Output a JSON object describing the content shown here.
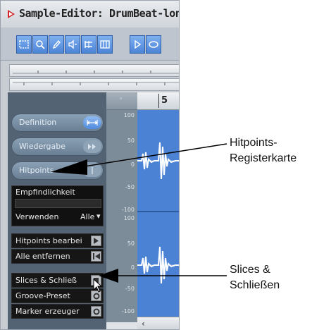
{
  "window": {
    "title": "Sample-Editor: DrumBeat-long"
  },
  "timeline": {
    "bar_label": "5"
  },
  "panel": {
    "tabs": [
      {
        "label": "Definition"
      },
      {
        "label": "Wiedergabe"
      },
      {
        "label": "Hitpoints"
      }
    ],
    "sensitivity_label": "Empfindlichkeit",
    "use_label": "Verwenden",
    "use_value": "Alle",
    "actions": [
      {
        "label": "Hitpoints bearbei"
      },
      {
        "label": "Alle entfernen"
      },
      {
        "label": "Slices & Schließ"
      },
      {
        "label": "Groove-Preset"
      },
      {
        "label": "Marker erzeuger"
      }
    ]
  },
  "scale": {
    "upper": [
      "100",
      "50",
      "0",
      "-50",
      "-100"
    ],
    "lower": [
      "100",
      "50",
      "0",
      "-50",
      "-100"
    ]
  },
  "annotations": {
    "hitpoints": [
      "Hitpoints-",
      "Registerkarte"
    ],
    "slices": [
      "Slices &",
      "Schließen"
    ]
  },
  "colors": {
    "wave": "#4c82d4",
    "panel": "#546373",
    "accent": "#4f8bde"
  }
}
